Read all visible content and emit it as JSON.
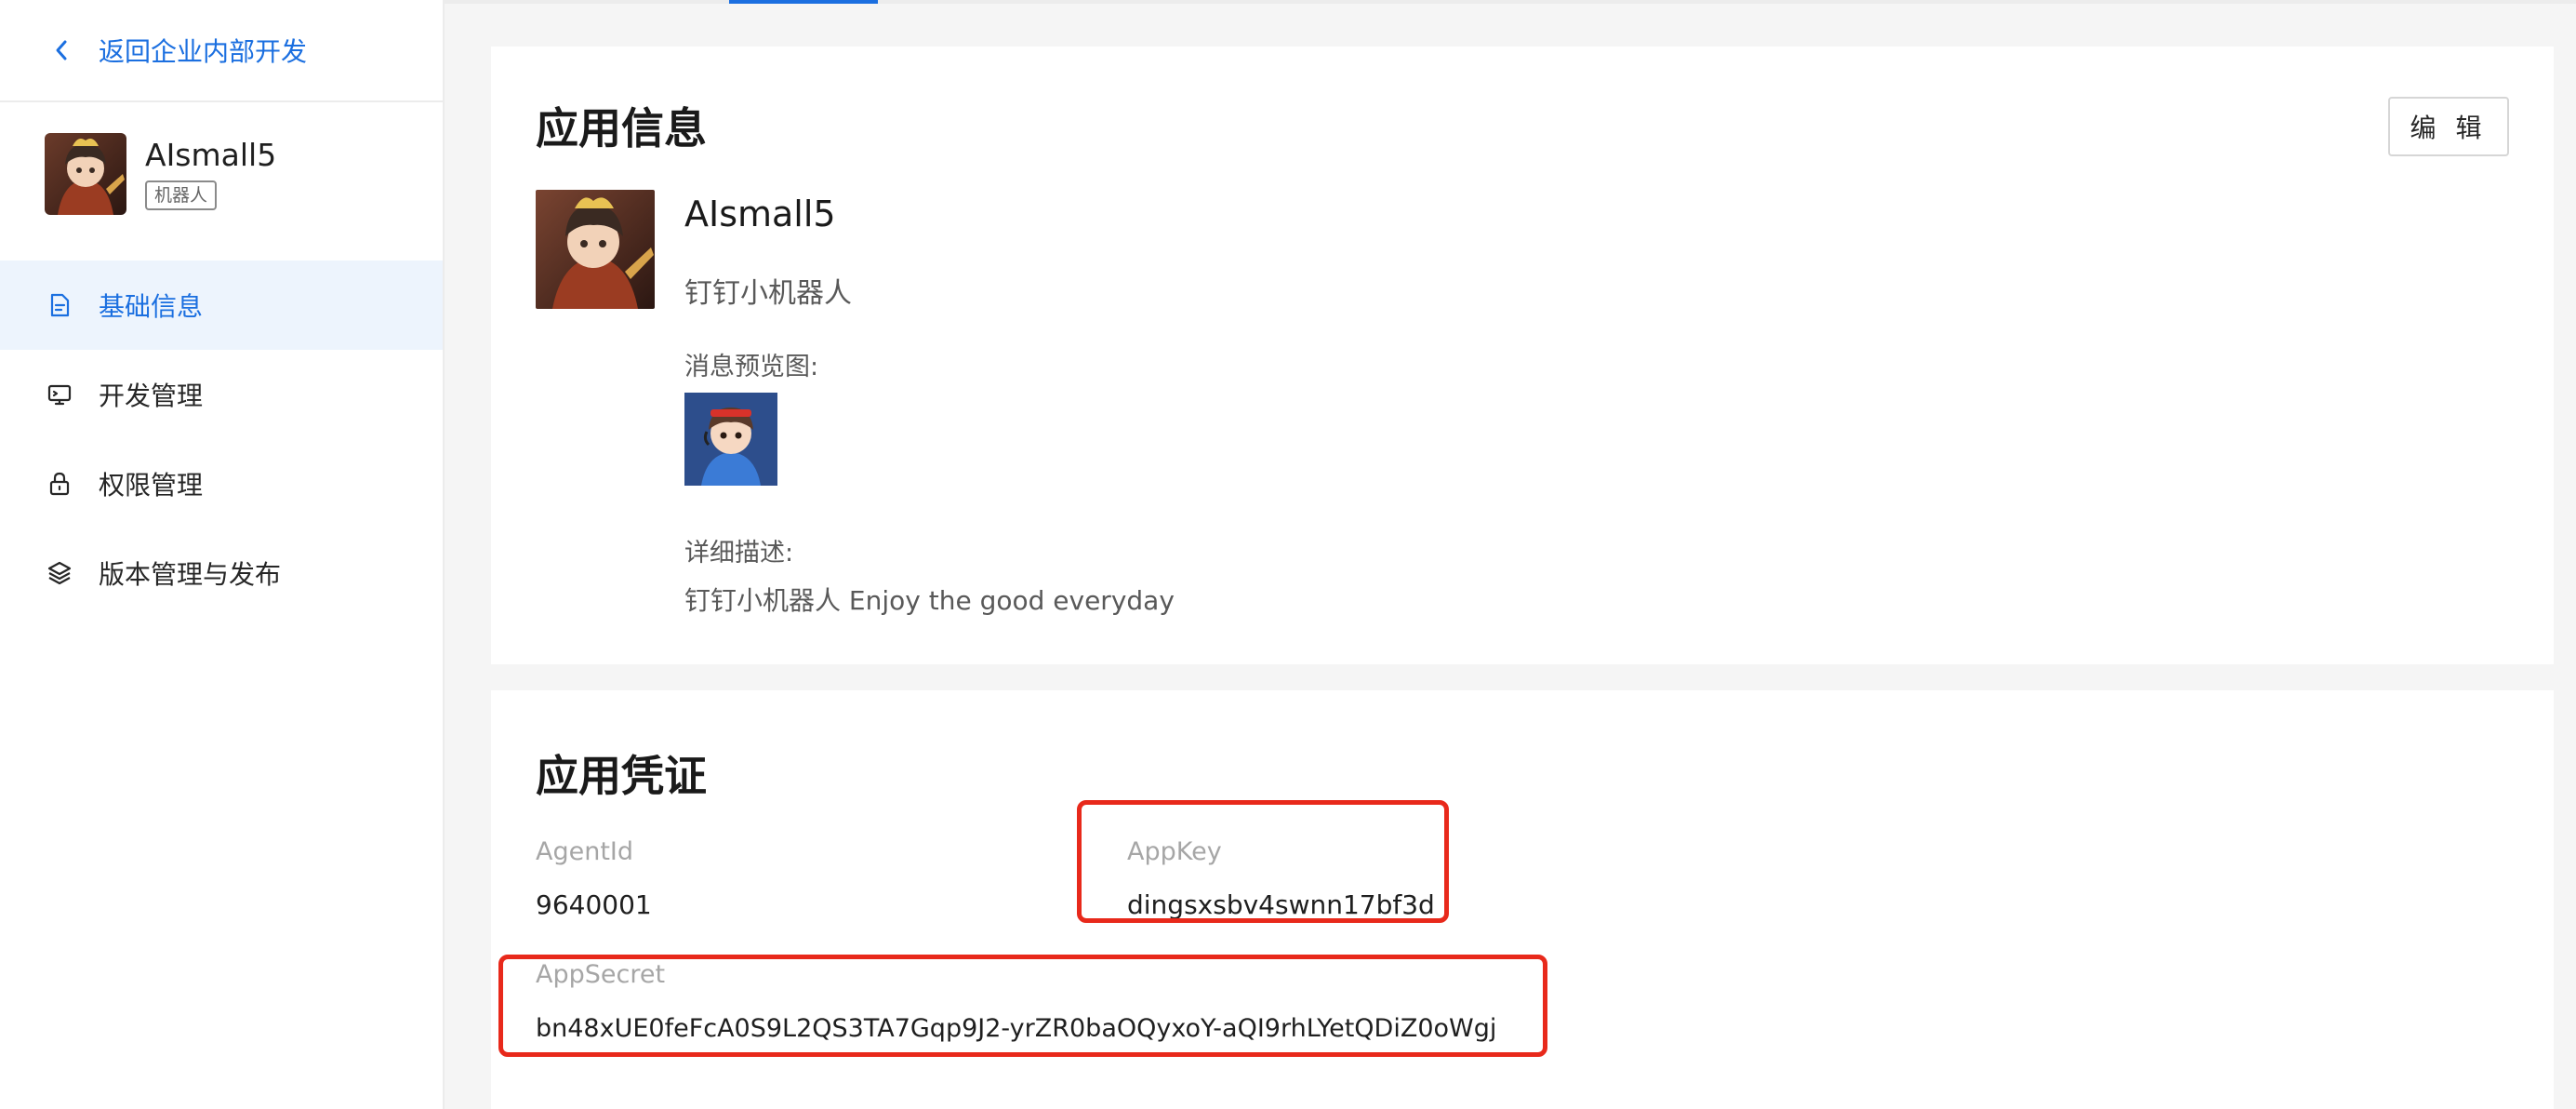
{
  "sidebar": {
    "back_label": "返回企业内部开发",
    "app_name": "AIsmall5",
    "app_tag": "机器人",
    "items": [
      {
        "label": "基础信息",
        "icon": "document-icon",
        "active": true
      },
      {
        "label": "开发管理",
        "icon": "monitor-icon",
        "active": false
      },
      {
        "label": "权限管理",
        "icon": "lock-icon",
        "active": false
      },
      {
        "label": "版本管理与发布",
        "icon": "layers-icon",
        "active": false
      }
    ]
  },
  "app_info": {
    "title": "应用信息",
    "edit_label": "编 辑",
    "name": "AIsmall5",
    "subtitle": "钉钉小机器人",
    "preview_label": "消息预览图:",
    "description_label": "详细描述:",
    "description": "钉钉小机器人 Enjoy the good everyday"
  },
  "credentials": {
    "title": "应用凭证",
    "agent_id_label": "AgentId",
    "agent_id": "9640001",
    "app_key_label": "AppKey",
    "app_key": "dingsxsbv4swnn17bf3d",
    "app_secret_label": "AppSecret",
    "app_secret": "bn48xUE0feFcA0S9L2QS3TA7Gqp9J2-yrZR0baOQyxoY-aQI9rhLYetQDiZ0oWgj"
  },
  "colors": {
    "accent": "#1b6fe0",
    "highlight": "#e8291b",
    "active_bg": "#edf4fd"
  }
}
